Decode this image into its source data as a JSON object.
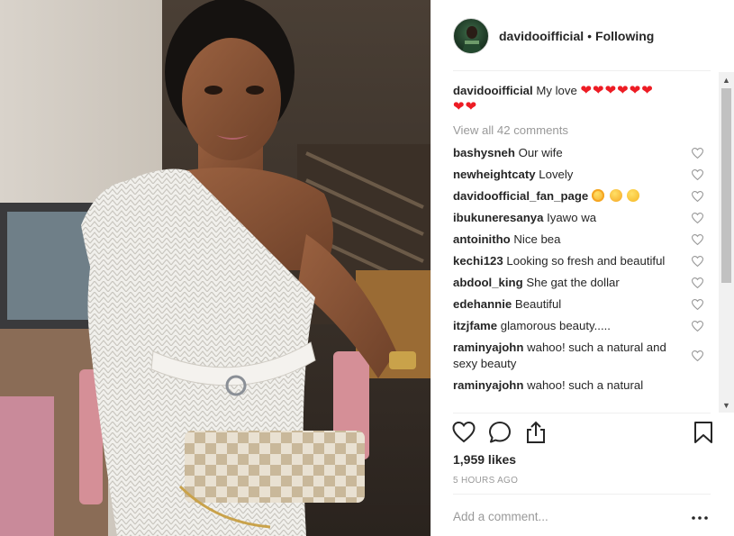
{
  "post": {
    "username": "davidooifficial",
    "separator": "•",
    "follow_status": "Following",
    "caption_user": "davidooifficial",
    "caption_text": "My love",
    "caption_hearts": "❤❤❤❤❤❤",
    "caption_hearts_2": "❤❤",
    "view_all": "View all 42 comments",
    "likes": "1,959 likes",
    "time_ago": "5 HOURS AGO",
    "add_comment_placeholder": "Add a comment..."
  },
  "comments": [
    {
      "user": "bashysneh",
      "text": "Our wife"
    },
    {
      "user": "newheightcaty",
      "text": "Lovely"
    },
    {
      "user": "davidoofficial_fan_page",
      "text": "",
      "emojis": [
        "star-struck-emoji",
        "kissing-wink-emoji",
        "smile-emoji"
      ]
    },
    {
      "user": "ibukuneresanya",
      "text": "Iyawo wa"
    },
    {
      "user": "antoinitho",
      "text": "Nice bea"
    },
    {
      "user": "kechi123",
      "text": "Looking so fresh and beautiful"
    },
    {
      "user": "abdool_king",
      "text": "She gat the dollar"
    },
    {
      "user": "edehannie",
      "text": "Beautiful"
    },
    {
      "user": "itzjfame",
      "text": "glamorous beauty....."
    },
    {
      "user": "raminyajohn",
      "text": "wahoo! such a natural and sexy beauty"
    },
    {
      "user": "raminyajohn",
      "text": "wahoo! such a natural"
    }
  ],
  "icons": {
    "avatar": "avatar-image",
    "like": "heart-outline-icon",
    "comment": "comment-bubble-icon",
    "share": "share-icon",
    "save": "bookmark-icon",
    "more": "more-options-icon",
    "scroll_up": "▲",
    "scroll_down": "▼"
  },
  "colors": {
    "heart_red": "#ed1c24",
    "meta_gray": "#999999",
    "text": "#262626"
  }
}
